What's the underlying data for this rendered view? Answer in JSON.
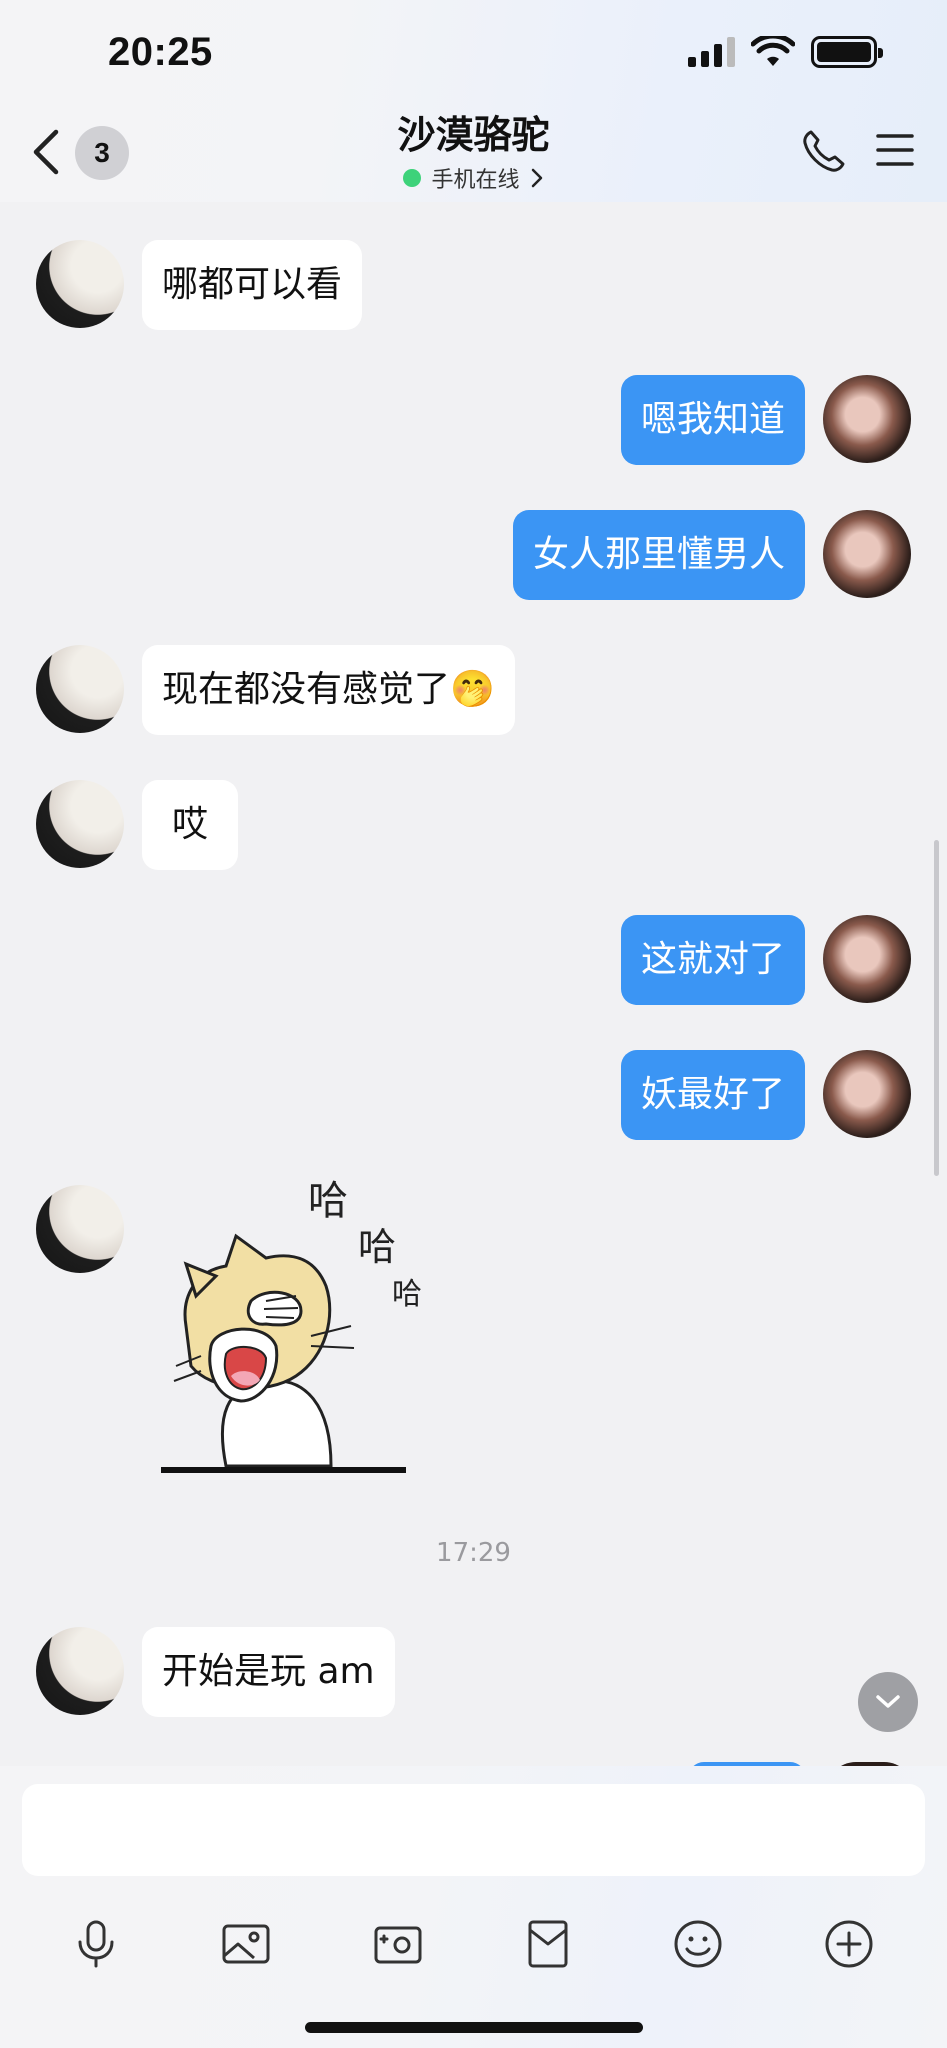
{
  "status_bar": {
    "time": "20:25"
  },
  "header": {
    "unread_count": "3",
    "title": "沙漠骆驼",
    "presence": "手机在线"
  },
  "messages": [
    {
      "side": "in",
      "text": "哪都可以看"
    },
    {
      "side": "out",
      "text": "嗯我知道"
    },
    {
      "side": "out",
      "text": "女人那里懂男人"
    },
    {
      "side": "in",
      "text": "现在都没有感觉了🤭"
    },
    {
      "side": "in",
      "text": "哎"
    },
    {
      "side": "out",
      "text": "这就对了"
    },
    {
      "side": "out",
      "text": "妖最好了"
    },
    {
      "side": "in",
      "type": "sticker",
      "sticker_text": [
        "哈",
        "哈",
        "哈"
      ]
    },
    {
      "side": "in",
      "text": "开始是玩 am"
    }
  ],
  "timestamp": "17:29",
  "input": {
    "placeholder": ""
  },
  "toolbar": {
    "items": [
      "microphone-icon",
      "image-icon",
      "camera-icon",
      "red-packet-icon",
      "emoji-icon",
      "plus-icon"
    ]
  },
  "colors": {
    "outgoing_bubble": "#3b95f4",
    "incoming_bubble": "#ffffff",
    "online": "#3dd27a"
  }
}
